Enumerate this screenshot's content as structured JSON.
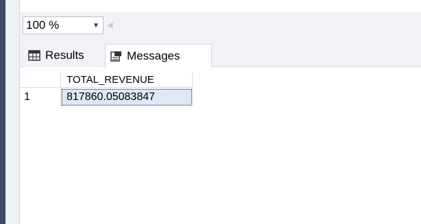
{
  "zoom": {
    "value": "100 %",
    "arrow_icon": "dropdown-arrow-icon",
    "scroll_icon": "scroll-left-icon"
  },
  "tabs": [
    {
      "label": "Results",
      "icon": "grid-icon"
    },
    {
      "label": "Messages",
      "icon": "messages-icon"
    }
  ],
  "grid": {
    "columns": [
      "TOTAL_REVENUE"
    ],
    "rows": [
      {
        "num": "1",
        "cells": [
          "817860.05083847"
        ]
      }
    ]
  },
  "colors": {
    "left_bar": "#3d4963",
    "toolbar_bg": "#f0f2f6",
    "selected_cell": "#dde8f7"
  }
}
